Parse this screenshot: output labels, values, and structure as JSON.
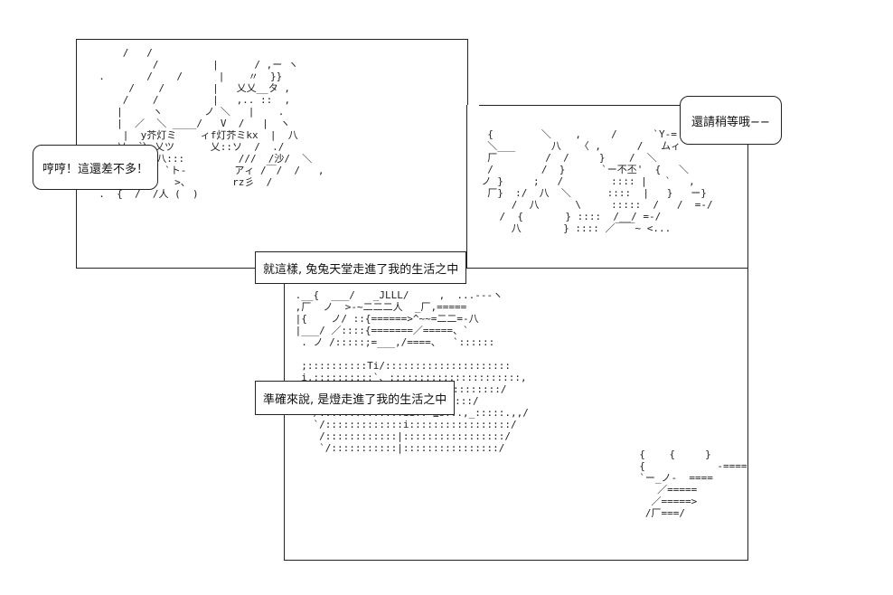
{
  "bubbles": {
    "left": "哼哼！這還差不多！",
    "right": "還請稍等哦−−"
  },
  "captions": {
    "first": "就這樣, 兔兔天堂走進了我的生活之中",
    "second": "準確來說, 是燈走進了我的生活之中"
  },
  "art": {
    "left_panel": "      /   /\n           /         |      / ,ー ヽ\n  .       /    /      |    〃  }}\n       /    /        |   乂乂__タ ,\n      /    /         |   ,.. ::  ,\n     |     ヽ       ノ ＼   |    .\n     |  ／  ＼ ____/   V  /   |  ヽ\n      |  y芥灯ミ    ィf灯芥ミkx  |  八\n     乂  込 乂ツ      乂::ソ  /  ./\n  |   ..八{ 八:::         ///  /沙/  ＼\n       /  |  `ト-        ̄アィ /￣/  /   ,\n      /   人   >、       rz彡  /\n  .  {  /  /人 (  )",
    "right_panel": "  {        ＼    ,     /      `Y-= \n  ＼___      八   〈 ,      /   ムィ\n  厂        /  /     }    /  ＼\n  /        /  }      `ー不丕'  {   ＼\n ノ }     ;   /        :::: |   `   ,\n  厂}  :/  八  ＼      ::::  |   }   ー}\n      /  八      \\     :::::  /   /  =-/\n    /  {       } ::::  /__/ =-/\n      八       } :::: ／￣￣~ <...",
    "bottom_panel": " .__{  ___/   _JLLL/     ,  ...---ヽ\n ,厂  ノ  >-~二二二人  _厂,=====\n |{    ノ/ ::{======>^~~=二二=-八 \n |___/ ／::::{=======／=====、`\n  . ノ /:::::;=___,/====、  `::::::\n   \n  ;::::::::::Ti/:::::::::::::::::::::\n  i,::::::::::`、::::::::::::::::::::::,\n  `>、::::::::>、:::::::::::::::::::/\n   `/:≧=-:::-=≦i>。,:::::::::::/\n    /::::::::::::::ii:: ≧s...,_:::::.,,/\n    `/:::::::::::::i:::::::::::::::::/\n     /::::::::::::|:::::::::::::::::/\n     `/:::::::::::|::::::::::::::::/",
    "bottom_right": "  {    {     }\n  {            -====\n  `ー_ノ-  ====\n     ／=====\n    ／=====>\n   /厂===/"
  }
}
